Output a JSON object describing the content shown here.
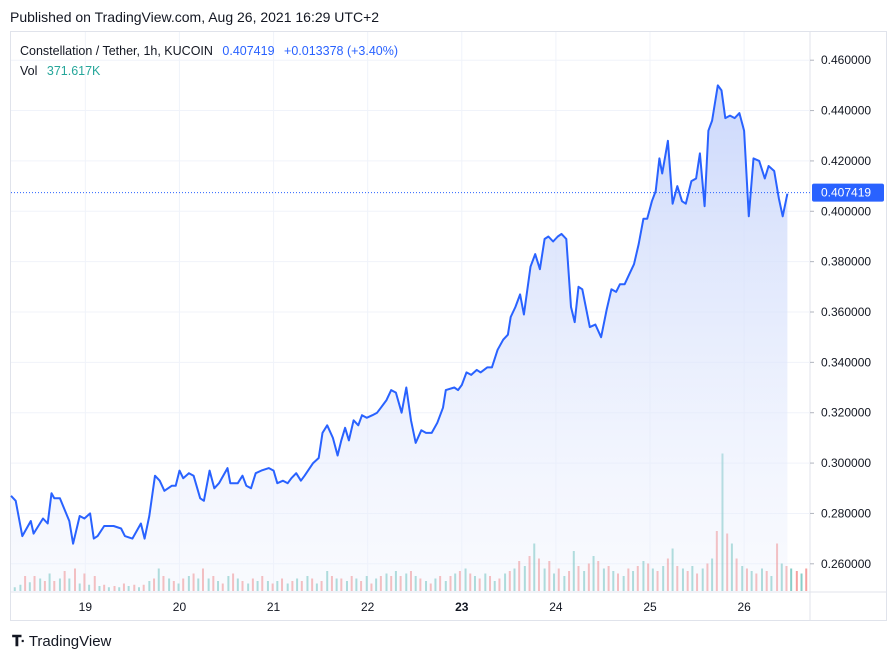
{
  "published": "Published on TradingView.com, Aug 26, 2021 16:29 UTC+2",
  "legend": {
    "symbol": "Constellation / Tether, 1h, KUCOIN",
    "last": "0.407419",
    "change": "+0.013378 (+3.40%)",
    "vol_label": "Vol",
    "vol_value": "371.617K"
  },
  "price_tag": "0.407419",
  "brand": "TradingView",
  "colors": {
    "line": "#2962ff",
    "area_top": "#c9d6fb",
    "vol_up": "#26a69a",
    "vol_down": "#ef5350",
    "grid": "#f0f3fa"
  },
  "chart_data": {
    "type": "area",
    "title": "Constellation / Tether, 1h, KUCOIN",
    "x_ticks": [
      {
        "label": "19",
        "x": 19.0,
        "bold": false
      },
      {
        "label": "20",
        "x": 20.0,
        "bold": false
      },
      {
        "label": "21",
        "x": 21.0,
        "bold": false
      },
      {
        "label": "22",
        "x": 22.0,
        "bold": false
      },
      {
        "label": "23",
        "x": 23.0,
        "bold": true
      },
      {
        "label": "24",
        "x": 24.0,
        "bold": false
      },
      {
        "label": "25",
        "x": 25.0,
        "bold": false
      },
      {
        "label": "26",
        "x": 26.0,
        "bold": false
      }
    ],
    "y_ticks": [
      "0.260000",
      "0.280000",
      "0.300000",
      "0.320000",
      "0.340000",
      "0.360000",
      "0.380000",
      "0.400000",
      "0.420000",
      "0.440000",
      "0.460000"
    ],
    "ylim": [
      0.2488,
      0.4712
    ],
    "xlim": [
      18.21,
      26.7
    ],
    "last_price": 0.407419,
    "grid": true,
    "legend_position": "top-left",
    "price_series": [
      [
        18.21,
        0.287
      ],
      [
        18.26,
        0.285
      ],
      [
        18.33,
        0.271
      ],
      [
        18.42,
        0.277
      ],
      [
        18.45,
        0.272
      ],
      [
        18.55,
        0.278
      ],
      [
        18.6,
        0.276
      ],
      [
        18.64,
        0.288
      ],
      [
        18.67,
        0.286
      ],
      [
        18.73,
        0.286
      ],
      [
        18.83,
        0.277
      ],
      [
        18.87,
        0.268
      ],
      [
        18.94,
        0.279
      ],
      [
        18.99,
        0.278
      ],
      [
        19.05,
        0.28
      ],
      [
        19.09,
        0.27
      ],
      [
        19.13,
        0.271
      ],
      [
        19.2,
        0.275
      ],
      [
        19.3,
        0.275
      ],
      [
        19.38,
        0.274
      ],
      [
        19.42,
        0.271
      ],
      [
        19.5,
        0.27
      ],
      [
        19.59,
        0.276
      ],
      [
        19.63,
        0.27
      ],
      [
        19.68,
        0.279
      ],
      [
        19.74,
        0.295
      ],
      [
        19.79,
        0.293
      ],
      [
        19.84,
        0.289
      ],
      [
        19.92,
        0.291
      ],
      [
        19.96,
        0.291
      ],
      [
        20.0,
        0.297
      ],
      [
        20.04,
        0.294
      ],
      [
        20.1,
        0.296
      ],
      [
        20.15,
        0.295
      ],
      [
        20.22,
        0.286
      ],
      [
        20.26,
        0.285
      ],
      [
        20.32,
        0.297
      ],
      [
        20.37,
        0.29
      ],
      [
        20.42,
        0.292
      ],
      [
        20.51,
        0.298
      ],
      [
        20.54,
        0.292
      ],
      [
        20.62,
        0.292
      ],
      [
        20.67,
        0.295
      ],
      [
        20.71,
        0.291
      ],
      [
        20.76,
        0.29
      ],
      [
        20.81,
        0.296
      ],
      [
        20.87,
        0.297
      ],
      [
        20.95,
        0.298
      ],
      [
        21.0,
        0.297
      ],
      [
        21.04,
        0.292
      ],
      [
        21.1,
        0.293
      ],
      [
        21.15,
        0.292
      ],
      [
        21.19,
        0.294
      ],
      [
        21.24,
        0.296
      ],
      [
        21.29,
        0.293
      ],
      [
        21.33,
        0.295
      ],
      [
        21.42,
        0.3
      ],
      [
        21.48,
        0.302
      ],
      [
        21.52,
        0.312
      ],
      [
        21.57,
        0.315
      ],
      [
        21.63,
        0.31
      ],
      [
        21.68,
        0.303
      ],
      [
        21.72,
        0.309
      ],
      [
        21.76,
        0.314
      ],
      [
        21.8,
        0.309
      ],
      [
        21.85,
        0.317
      ],
      [
        21.9,
        0.315
      ],
      [
        21.94,
        0.319
      ],
      [
        21.99,
        0.318
      ],
      [
        22.05,
        0.319
      ],
      [
        22.1,
        0.32
      ],
      [
        22.14,
        0.322
      ],
      [
        22.2,
        0.325
      ],
      [
        22.25,
        0.329
      ],
      [
        22.3,
        0.328
      ],
      [
        22.36,
        0.32
      ],
      [
        22.41,
        0.33
      ],
      [
        22.46,
        0.317
      ],
      [
        22.51,
        0.308
      ],
      [
        22.57,
        0.313
      ],
      [
        22.62,
        0.312
      ],
      [
        22.68,
        0.312
      ],
      [
        22.74,
        0.316
      ],
      [
        22.8,
        0.322
      ],
      [
        22.83,
        0.329
      ],
      [
        22.92,
        0.33
      ],
      [
        22.96,
        0.329
      ],
      [
        23.0,
        0.331
      ],
      [
        23.05,
        0.336
      ],
      [
        23.1,
        0.335
      ],
      [
        23.16,
        0.337
      ],
      [
        23.2,
        0.336
      ],
      [
        23.27,
        0.338
      ],
      [
        23.32,
        0.338
      ],
      [
        23.38,
        0.345
      ],
      [
        23.44,
        0.349
      ],
      [
        23.49,
        0.351
      ],
      [
        23.52,
        0.358
      ],
      [
        23.57,
        0.362
      ],
      [
        23.62,
        0.367
      ],
      [
        23.66,
        0.359
      ],
      [
        23.73,
        0.378
      ],
      [
        23.78,
        0.383
      ],
      [
        23.83,
        0.377
      ],
      [
        23.88,
        0.389
      ],
      [
        23.92,
        0.39
      ],
      [
        23.97,
        0.388
      ],
      [
        24.02,
        0.39
      ],
      [
        24.06,
        0.391
      ],
      [
        24.11,
        0.389
      ],
      [
        24.16,
        0.362
      ],
      [
        24.2,
        0.356
      ],
      [
        24.24,
        0.37
      ],
      [
        24.28,
        0.369
      ],
      [
        24.36,
        0.354
      ],
      [
        24.42,
        0.355
      ],
      [
        24.48,
        0.35
      ],
      [
        24.54,
        0.361
      ],
      [
        24.59,
        0.369
      ],
      [
        24.64,
        0.368
      ],
      [
        24.68,
        0.371
      ],
      [
        24.73,
        0.371
      ],
      [
        24.78,
        0.375
      ],
      [
        24.83,
        0.379
      ],
      [
        24.88,
        0.387
      ],
      [
        24.93,
        0.397
      ],
      [
        24.97,
        0.397
      ],
      [
        25.02,
        0.404
      ],
      [
        25.06,
        0.408
      ],
      [
        25.1,
        0.421
      ],
      [
        25.13,
        0.415
      ],
      [
        25.19,
        0.428
      ],
      [
        25.24,
        0.403
      ],
      [
        25.29,
        0.41
      ],
      [
        25.34,
        0.404
      ],
      [
        25.38,
        0.403
      ],
      [
        25.44,
        0.412
      ],
      [
        25.49,
        0.413
      ],
      [
        25.53,
        0.423
      ],
      [
        25.58,
        0.402
      ],
      [
        25.62,
        0.432
      ],
      [
        25.66,
        0.436
      ],
      [
        25.72,
        0.45
      ],
      [
        25.76,
        0.448
      ],
      [
        25.8,
        0.437
      ],
      [
        25.85,
        0.438
      ],
      [
        25.9,
        0.437
      ],
      [
        25.95,
        0.439
      ],
      [
        26.0,
        0.432
      ],
      [
        26.05,
        0.398
      ],
      [
        26.1,
        0.421
      ],
      [
        26.16,
        0.42
      ],
      [
        26.22,
        0.413
      ],
      [
        26.26,
        0.418
      ],
      [
        26.32,
        0.416
      ],
      [
        26.37,
        0.405
      ],
      [
        26.41,
        0.398
      ],
      [
        26.46,
        0.407
      ]
    ],
    "volume_series": [
      [
        18.25,
        3,
        1
      ],
      [
        18.31,
        5,
        1
      ],
      [
        18.36,
        12,
        0
      ],
      [
        18.41,
        7,
        1
      ],
      [
        18.46,
        12,
        0
      ],
      [
        18.52,
        10,
        1
      ],
      [
        18.57,
        8,
        0
      ],
      [
        18.62,
        14,
        1
      ],
      [
        18.67,
        8,
        0
      ],
      [
        18.73,
        10,
        1
      ],
      [
        18.78,
        16,
        0
      ],
      [
        18.83,
        10,
        1
      ],
      [
        18.89,
        18,
        0
      ],
      [
        18.94,
        6,
        1
      ],
      [
        18.99,
        14,
        0
      ],
      [
        19.04,
        5,
        1
      ],
      [
        19.1,
        12,
        0
      ],
      [
        19.15,
        4,
        1
      ],
      [
        19.2,
        5,
        0
      ],
      [
        19.25,
        3,
        1
      ],
      [
        19.31,
        4,
        0
      ],
      [
        19.36,
        3,
        1
      ],
      [
        19.41,
        6,
        0
      ],
      [
        19.46,
        4,
        1
      ],
      [
        19.52,
        5,
        0
      ],
      [
        19.57,
        3,
        1
      ],
      [
        19.62,
        5,
        0
      ],
      [
        19.68,
        8,
        1
      ],
      [
        19.73,
        10,
        0
      ],
      [
        19.78,
        18,
        1
      ],
      [
        19.83,
        12,
        0
      ],
      [
        19.89,
        10,
        1
      ],
      [
        19.94,
        8,
        0
      ],
      [
        19.99,
        6,
        1
      ],
      [
        20.04,
        10,
        0
      ],
      [
        20.1,
        12,
        1
      ],
      [
        20.15,
        14,
        0
      ],
      [
        20.2,
        10,
        1
      ],
      [
        20.25,
        18,
        0
      ],
      [
        20.31,
        10,
        1
      ],
      [
        20.36,
        12,
        0
      ],
      [
        20.41,
        8,
        1
      ],
      [
        20.46,
        6,
        0
      ],
      [
        20.52,
        12,
        1
      ],
      [
        20.57,
        14,
        0
      ],
      [
        20.62,
        10,
        1
      ],
      [
        20.67,
        8,
        0
      ],
      [
        20.73,
        6,
        1
      ],
      [
        20.78,
        10,
        0
      ],
      [
        20.83,
        8,
        1
      ],
      [
        20.88,
        12,
        0
      ],
      [
        20.94,
        8,
        1
      ],
      [
        20.99,
        6,
        0
      ],
      [
        21.04,
        8,
        1
      ],
      [
        21.09,
        10,
        0
      ],
      [
        21.15,
        6,
        1
      ],
      [
        21.2,
        8,
        0
      ],
      [
        21.25,
        10,
        1
      ],
      [
        21.3,
        8,
        0
      ],
      [
        21.36,
        12,
        1
      ],
      [
        21.41,
        10,
        0
      ],
      [
        21.46,
        6,
        1
      ],
      [
        21.51,
        8,
        0
      ],
      [
        21.57,
        16,
        1
      ],
      [
        21.62,
        12,
        0
      ],
      [
        21.67,
        10,
        1
      ],
      [
        21.72,
        10,
        0
      ],
      [
        21.78,
        8,
        1
      ],
      [
        21.83,
        12,
        0
      ],
      [
        21.88,
        10,
        1
      ],
      [
        21.93,
        8,
        0
      ],
      [
        21.99,
        12,
        1
      ],
      [
        22.04,
        6,
        0
      ],
      [
        22.09,
        10,
        1
      ],
      [
        22.14,
        12,
        0
      ],
      [
        22.2,
        14,
        1
      ],
      [
        22.25,
        12,
        0
      ],
      [
        22.3,
        16,
        1
      ],
      [
        22.35,
        12,
        0
      ],
      [
        22.41,
        14,
        1
      ],
      [
        22.46,
        16,
        0
      ],
      [
        22.51,
        12,
        1
      ],
      [
        22.56,
        10,
        0
      ],
      [
        22.62,
        8,
        1
      ],
      [
        22.67,
        6,
        0
      ],
      [
        22.72,
        10,
        1
      ],
      [
        22.77,
        12,
        0
      ],
      [
        22.83,
        8,
        1
      ],
      [
        22.88,
        12,
        0
      ],
      [
        22.93,
        14,
        1
      ],
      [
        22.98,
        16,
        0
      ],
      [
        23.04,
        18,
        1
      ],
      [
        23.09,
        14,
        0
      ],
      [
        23.14,
        12,
        1
      ],
      [
        23.19,
        10,
        0
      ],
      [
        23.25,
        14,
        1
      ],
      [
        23.3,
        12,
        0
      ],
      [
        23.35,
        8,
        1
      ],
      [
        23.4,
        10,
        0
      ],
      [
        23.46,
        14,
        1
      ],
      [
        23.51,
        16,
        0
      ],
      [
        23.56,
        18,
        1
      ],
      [
        23.61,
        24,
        0
      ],
      [
        23.67,
        20,
        1
      ],
      [
        23.72,
        28,
        0
      ],
      [
        23.77,
        38,
        1
      ],
      [
        23.82,
        26,
        0
      ],
      [
        23.88,
        18,
        1
      ],
      [
        23.93,
        24,
        0
      ],
      [
        23.98,
        14,
        1
      ],
      [
        24.03,
        18,
        0
      ],
      [
        24.09,
        12,
        1
      ],
      [
        24.14,
        16,
        0
      ],
      [
        24.19,
        32,
        1
      ],
      [
        24.24,
        20,
        0
      ],
      [
        24.3,
        16,
        1
      ],
      [
        24.35,
        22,
        0
      ],
      [
        24.4,
        28,
        1
      ],
      [
        24.45,
        24,
        0
      ],
      [
        24.51,
        18,
        1
      ],
      [
        24.56,
        20,
        0
      ],
      [
        24.61,
        16,
        1
      ],
      [
        24.66,
        14,
        0
      ],
      [
        24.72,
        12,
        1
      ],
      [
        24.77,
        18,
        0
      ],
      [
        24.82,
        16,
        1
      ],
      [
        24.87,
        20,
        0
      ],
      [
        24.93,
        24,
        1
      ],
      [
        24.98,
        22,
        0
      ],
      [
        25.03,
        18,
        1
      ],
      [
        25.08,
        16,
        0
      ],
      [
        25.14,
        20,
        1
      ],
      [
        25.19,
        26,
        0
      ],
      [
        25.24,
        34,
        1
      ],
      [
        25.29,
        20,
        0
      ],
      [
        25.35,
        18,
        1
      ],
      [
        25.4,
        16,
        0
      ],
      [
        25.45,
        20,
        1
      ],
      [
        25.5,
        14,
        0
      ],
      [
        25.56,
        18,
        1
      ],
      [
        25.61,
        22,
        0
      ],
      [
        25.66,
        26,
        1
      ],
      [
        25.71,
        48,
        0
      ],
      [
        25.77,
        110,
        1
      ],
      [
        25.82,
        46,
        0
      ],
      [
        25.87,
        38,
        1
      ],
      [
        25.92,
        26,
        0
      ],
      [
        25.98,
        20,
        1
      ],
      [
        26.03,
        18,
        0
      ],
      [
        26.08,
        16,
        1
      ],
      [
        26.13,
        14,
        0
      ],
      [
        26.19,
        18,
        1
      ],
      [
        26.24,
        16,
        0
      ],
      [
        26.29,
        12,
        1
      ],
      [
        26.35,
        38,
        0
      ],
      [
        26.4,
        22,
        1
      ],
      [
        26.45,
        20,
        0
      ],
      [
        26.5,
        18,
        1
      ],
      [
        26.56,
        16,
        0
      ],
      [
        26.61,
        14,
        1
      ],
      [
        26.66,
        18,
        0
      ]
    ]
  }
}
